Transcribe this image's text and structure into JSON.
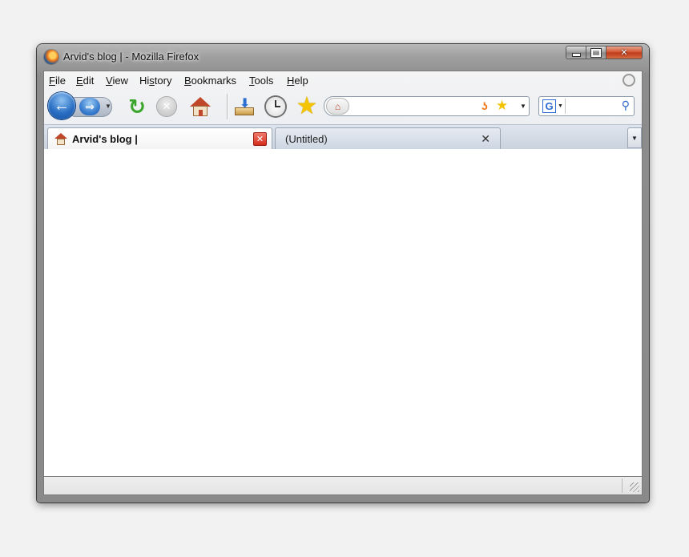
{
  "window": {
    "title": "Arvid's blog | - Mozilla Firefox",
    "controls": {
      "minimize_icon": "minimize-icon",
      "maximize_icon": "maximize-icon",
      "close_glyph": "✕"
    }
  },
  "menubar": {
    "items": [
      {
        "accel": "F",
        "rest": "ile"
      },
      {
        "accel": "E",
        "rest": "dit"
      },
      {
        "accel": "V",
        "rest": "iew"
      },
      {
        "pre": "Hi",
        "accel": "s",
        "rest": "tory"
      },
      {
        "accel": "B",
        "rest": "ookmarks"
      },
      {
        "accel": "T",
        "rest": "ools"
      },
      {
        "accel": "H",
        "rest": "elp"
      }
    ]
  },
  "navbar": {
    "back_glyph": "←",
    "forward_glyph": "⇒",
    "dropdown_glyph": "▼",
    "reload_glyph": "↻",
    "stop_glyph": "✕",
    "icons": [
      "back-icon",
      "forward-icon",
      "reload-icon",
      "stop-icon",
      "home-icon",
      "downloads-icon",
      "history-icon",
      "bookmark-star-icon"
    ],
    "star_glyph": "★",
    "download_arrow": "⬇",
    "url": {
      "value": "",
      "placeholder": "",
      "site_glyph": "⌂",
      "feed_glyph": "ʖ",
      "star_glyph": "★",
      "dropdown_glyph": "▼"
    },
    "search": {
      "engine_letter": "G",
      "dropdown_glyph": "▼",
      "value": "",
      "placeholder": "",
      "go_glyph": "⚲"
    }
  },
  "tabs": {
    "items": [
      {
        "label": "Arvid's blog |",
        "active": true,
        "close_glyph": "✕"
      },
      {
        "label": "(Untitled)",
        "active": false,
        "close_glyph": "✕"
      }
    ],
    "all_tabs_glyph": "▼"
  },
  "statusbar": {
    "text": ""
  },
  "colors": {
    "accent": "#2a6fc4",
    "tab_close": "#d32c1c",
    "window_frame": "#8c8c8c"
  }
}
